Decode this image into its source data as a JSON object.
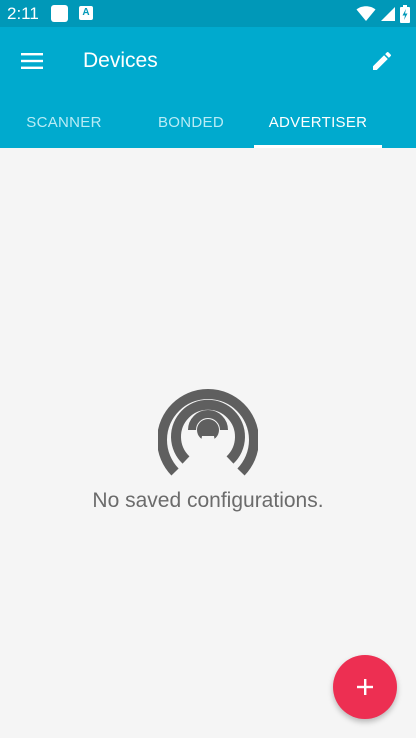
{
  "status_bar": {
    "time": "2:11",
    "notification_letter": "A",
    "icons": [
      "notification-square-icon",
      "notification-a-icon",
      "wifi-icon",
      "signal-icon",
      "battery-charging-icon"
    ]
  },
  "app_bar": {
    "title": "Devices",
    "menu_icon": "hamburger-menu-icon",
    "edit_icon": "pencil-icon"
  },
  "tabs": [
    {
      "label": "SCANNER",
      "active": false
    },
    {
      "label": "BONDED",
      "active": false
    },
    {
      "label": "ADVERTISER",
      "active": true
    }
  ],
  "empty_state": {
    "icon": "broadcast-icon",
    "message": "No saved configurations."
  },
  "fab": {
    "icon": "plus-icon"
  },
  "colors": {
    "status_bar": "#0098b8",
    "primary": "#00aace",
    "background": "#f5f5f5",
    "accent": "#ed2f52",
    "tab_inactive": "#b9ecf6",
    "empty_icon": "#5f5f5f",
    "empty_text": "#6b6b6b"
  }
}
